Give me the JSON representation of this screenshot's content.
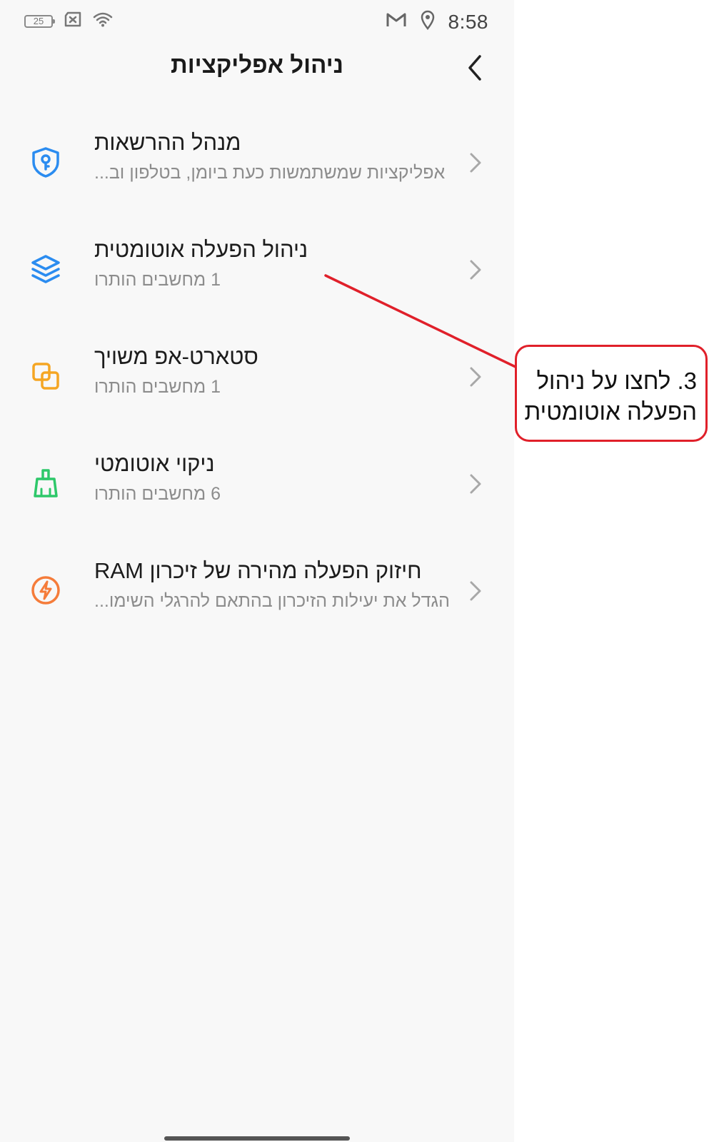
{
  "status_bar": {
    "battery_level": "25",
    "time": "8:58",
    "icons": [
      "battery-icon",
      "sim-missing-icon",
      "wifi-icon",
      "gmail-icon",
      "location-icon"
    ]
  },
  "header": {
    "title": "ניהול אפליקציות",
    "back_icon": "chevron-left-icon"
  },
  "items": [
    {
      "label": "מנהל ההרשאות",
      "sub": "אפליקציות שמשתמשות כעת ביומן, בטלפון וב...",
      "icon": "shield-key-icon",
      "color": "#2b8cf0"
    },
    {
      "label": "ניהול הפעלה אוטומטית",
      "sub": "1 מחשבים הותרו",
      "icon": "layers-icon",
      "color": "#2b8cf0"
    },
    {
      "label": "סטארט-אפ משויך",
      "sub": "1 מחשבים הותרו",
      "icon": "linked-squares-icon",
      "color": "#f5a623"
    },
    {
      "label": "ניקוי אוטומטי",
      "sub": "6 מחשבים הותרו",
      "icon": "broom-icon",
      "color": "#2ec86a"
    },
    {
      "label": "חיזוק הפעלה מהירה של זיכרון RAM",
      "sub": "הגדל את יעילות הזיכרון בהתאם להרגלי השימו...",
      "icon": "lightning-circle-icon",
      "color": "#f57c3a"
    }
  ],
  "annotation": {
    "text": "3. לחצו על ניהול הפעלה אוטומטית",
    "color": "#e0202a"
  }
}
